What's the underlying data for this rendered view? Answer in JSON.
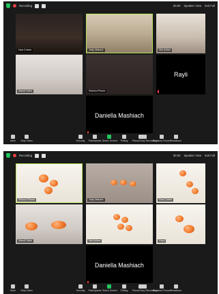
{
  "screens": [
    {
      "topbar": {
        "recording": "Recording",
        "right": [
          "00:00",
          "Speaker View",
          "Exit Full"
        ]
      },
      "tiles": [
        {
          "name": "Noa Cohen"
        },
        {
          "name": "Judy Malone"
        },
        {
          "name": "Mia Avitan"
        },
        {
          "name": "Mazal Dahe"
        },
        {
          "name": "Shira's iPhone"
        },
        {
          "name": "Rayli"
        },
        {
          "name": "Daniella Mashiach"
        }
      ],
      "bottombar": [
        "Mute",
        "Stop Video",
        "Security",
        "Participants",
        "Share Screen",
        "Polling",
        "Pause/Stop Recording",
        "Breakout Rooms",
        "Reactions"
      ]
    },
    {
      "topbar": {
        "recording": "Recording",
        "right": [
          "00:00",
          "Speaker View",
          "Exit Full"
        ]
      },
      "tiles": [
        {
          "name": "Shira's iPhone"
        },
        {
          "name": "Judy Malone"
        },
        {
          "name": "Noa Cohen"
        },
        {
          "name": "Mazal Dahe"
        },
        {
          "name": "Mia Avitan"
        },
        {
          "name": "Rayli"
        },
        {
          "name": "Daniella Mashiach"
        }
      ],
      "bottombar": [
        "Mute",
        "Stop Video",
        "Security",
        "Participants",
        "Share Screen",
        "Polling",
        "Pause/Stop Recording",
        "Breakout Rooms",
        "Reactions"
      ]
    }
  ],
  "colors": {
    "active_speaker_border": "#b7e05a",
    "record_red": "#ef4444",
    "security_green": "#22c55e"
  }
}
